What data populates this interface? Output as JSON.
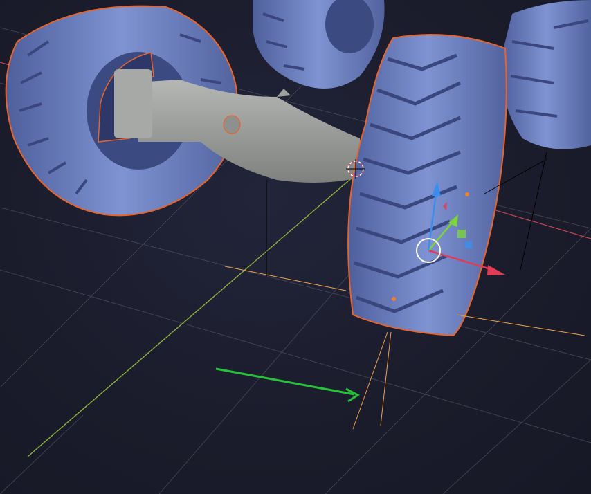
{
  "viewport": {
    "background_color": "#1b1d2c",
    "grid_color": "#4a4d5c",
    "y_axis_color": "#8ab03a",
    "x_axis_color": "#c24455",
    "selection_outline_color": "#e8642a",
    "wheel_color": "#6f83c4",
    "axle_color": "#9a9c9a",
    "light_guide_color": "#f0a04a"
  },
  "objects": [
    {
      "name": "tire-rear-left",
      "selected": true
    },
    {
      "name": "tire-rear-mid",
      "selected": false
    },
    {
      "name": "tire-right-back",
      "selected": false
    },
    {
      "name": "tire-front-right",
      "selected": true,
      "active": true
    },
    {
      "name": "axle",
      "selected": false
    }
  ],
  "gizmo": {
    "type": "move",
    "axes": [
      {
        "axis": "x",
        "color": "#e23b55"
      },
      {
        "axis": "y",
        "color": "#7bd43a"
      },
      {
        "axis": "z",
        "color": "#3a8ef0"
      }
    ],
    "center_color": "#ffffff"
  },
  "annotation": {
    "type": "arrow",
    "color": "#27c23a"
  }
}
